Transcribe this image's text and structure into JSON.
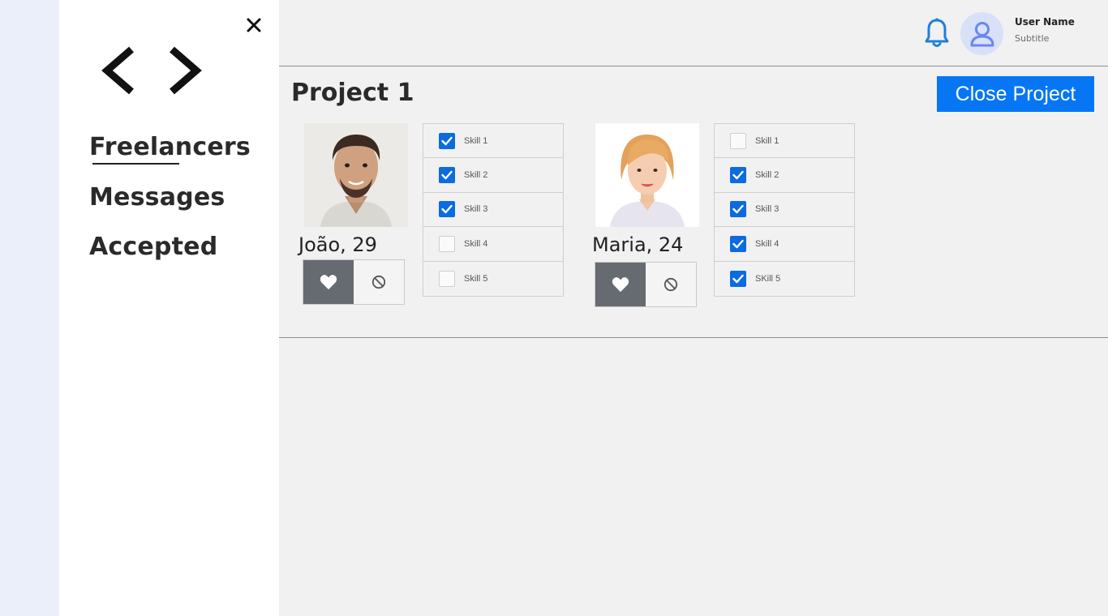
{
  "sidebar": {
    "nav": [
      {
        "label": "Freelancers"
      },
      {
        "label": "Messages"
      },
      {
        "label": "Accepted"
      }
    ]
  },
  "header": {
    "user_name": "User Name",
    "user_subtitle": "Subtitle"
  },
  "project": {
    "title": "Project 1",
    "close_label": "Close Project"
  },
  "colors": {
    "accent": "#0676f5",
    "checkbox": "#0b6be0",
    "like_button": "#666b71"
  },
  "freelancers": [
    {
      "name": "João, 29",
      "skills": [
        {
          "label": "Skill 1",
          "checked": true
        },
        {
          "label": "Skill 2",
          "checked": true
        },
        {
          "label": "Skill 3",
          "checked": true
        },
        {
          "label": "Skill 4",
          "checked": false
        },
        {
          "label": "Skill 5",
          "checked": false
        }
      ]
    },
    {
      "name": "Maria, 24",
      "skills": [
        {
          "label": "Skill 1",
          "checked": false
        },
        {
          "label": "Skill 2",
          "checked": true
        },
        {
          "label": "Skill 3",
          "checked": true
        },
        {
          "label": "Skill 4",
          "checked": true
        },
        {
          "label": "SKill 5",
          "checked": true
        }
      ]
    }
  ]
}
